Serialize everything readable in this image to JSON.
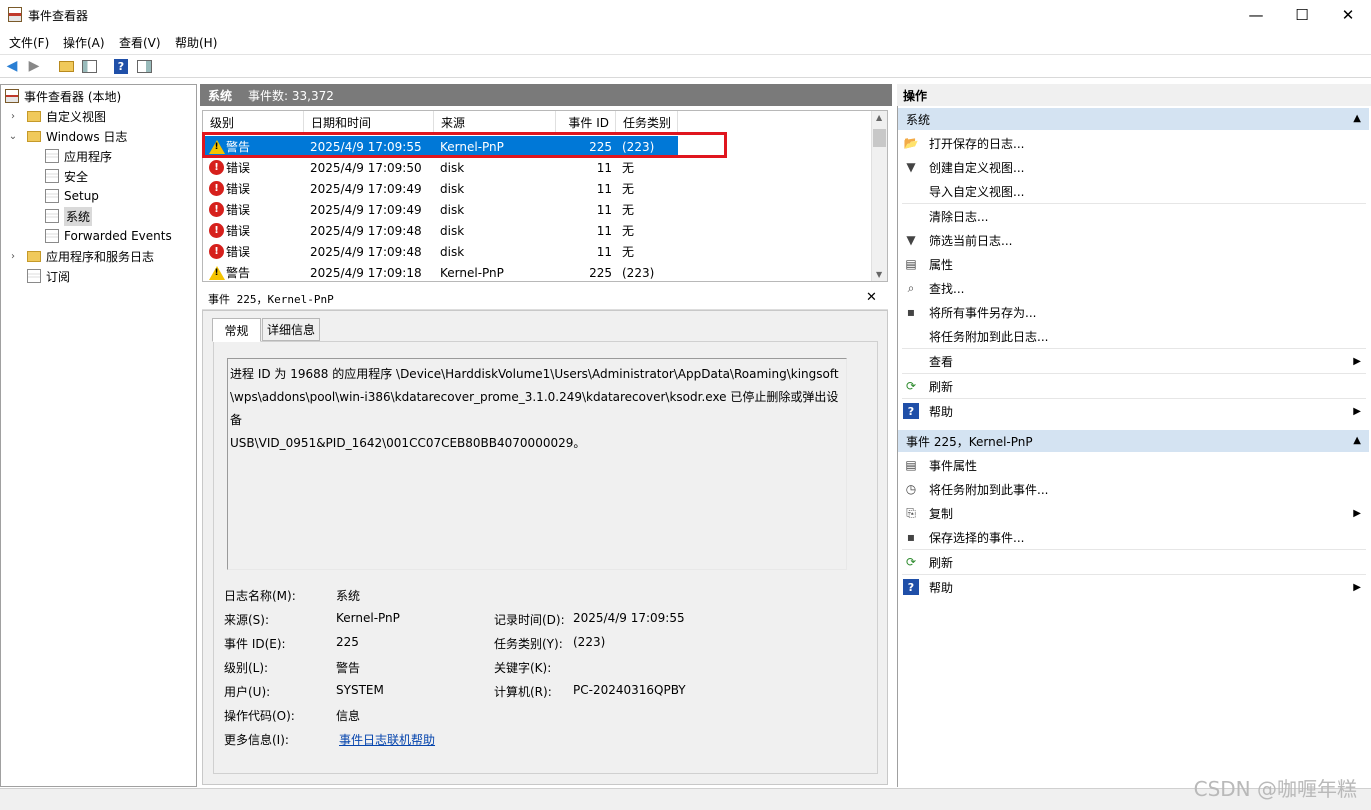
{
  "window": {
    "title": "事件查看器",
    "minimize": "—",
    "maximize": "☐",
    "close": "✕"
  },
  "menu": [
    "文件(F)",
    "操作(A)",
    "查看(V)",
    "帮助(H)"
  ],
  "tree": {
    "root": "事件查看器 (本地)",
    "custom_views": "自定义视图",
    "windows_logs": "Windows 日志",
    "logs": [
      "应用程序",
      "安全",
      "Setup",
      "系统",
      "Forwarded Events"
    ],
    "app_service_logs": "应用程序和服务日志",
    "subscriptions": "订阅"
  },
  "center": {
    "log_name": "系统",
    "event_count": "事件数: 33,372",
    "columns": [
      "级别",
      "日期和时间",
      "来源",
      "事件 ID",
      "任务类别"
    ],
    "rows": [
      {
        "level": "警告",
        "type": "warning",
        "datetime": "2025/4/9 17:09:55",
        "source": "Kernel-PnP",
        "id": "225",
        "task": "(223)",
        "selected": true
      },
      {
        "level": "错误",
        "type": "error",
        "datetime": "2025/4/9 17:09:50",
        "source": "disk",
        "id": "11",
        "task": "无"
      },
      {
        "level": "错误",
        "type": "error",
        "datetime": "2025/4/9 17:09:49",
        "source": "disk",
        "id": "11",
        "task": "无"
      },
      {
        "level": "错误",
        "type": "error",
        "datetime": "2025/4/9 17:09:49",
        "source": "disk",
        "id": "11",
        "task": "无"
      },
      {
        "level": "错误",
        "type": "error",
        "datetime": "2025/4/9 17:09:48",
        "source": "disk",
        "id": "11",
        "task": "无"
      },
      {
        "level": "错误",
        "type": "error",
        "datetime": "2025/4/9 17:09:48",
        "source": "disk",
        "id": "11",
        "task": "无"
      },
      {
        "level": "警告",
        "type": "warning",
        "datetime": "2025/4/9 17:09:18",
        "source": "Kernel-PnP",
        "id": "225",
        "task": "(223)"
      }
    ]
  },
  "detail": {
    "header": "事件 225，Kernel-PnP",
    "close": "✕",
    "tabs": [
      "常规",
      "详细信息"
    ],
    "description_lines": [
      "进程 ID 为 19688 的应用程序 \\Device\\HarddiskVolume1\\Users\\Administrator\\AppData\\Roaming\\kingsoft",
      "\\wps\\addons\\pool\\win-i386\\kdatarecover_prome_3.1.0.249\\kdatarecover\\ksodr.exe 已停止删除或弹出设备",
      "USB\\VID_0951&PID_1642\\001CC07CEB80BB4070000029。"
    ],
    "fields": {
      "log_name_label": "日志名称(M):",
      "log_name": "系统",
      "source_label": "来源(S):",
      "source": "Kernel-PnP",
      "logged_label": "记录时间(D):",
      "logged": "2025/4/9 17:09:55",
      "event_id_label": "事件 ID(E):",
      "event_id": "225",
      "task_label": "任务类别(Y):",
      "task": "(223)",
      "level_label": "级别(L):",
      "level": "警告",
      "keywords_label": "关键字(K):",
      "user_label": "用户(U):",
      "user": "SYSTEM",
      "computer_label": "计算机(R):",
      "computer": "PC-20240316QPBY",
      "opcode_label": "操作代码(O):",
      "opcode": "信息",
      "more_info_label": "更多信息(I):",
      "more_info_link": "事件日志联机帮助"
    }
  },
  "actions": {
    "title": "操作",
    "section1": "系统",
    "section1_items": [
      "打开保存的日志...",
      "创建自定义视图...",
      "导入自定义视图...",
      "清除日志...",
      "筛选当前日志...",
      "属性",
      "查找...",
      "将所有事件另存为...",
      "将任务附加到此日志...",
      "查看",
      "刷新",
      "帮助"
    ],
    "section2": "事件 225，Kernel-PnP",
    "section2_items": [
      "事件属性",
      "将任务附加到此事件...",
      "复制",
      "保存选择的事件...",
      "刷新",
      "帮助"
    ]
  },
  "watermark": "CSDN @咖喱年糕",
  "colors": {
    "selection": "#0078d7",
    "highlight_box": "#e0161e",
    "section_head": "#d4e3f2",
    "warning": "#f5c400",
    "error": "#d6201c"
  }
}
